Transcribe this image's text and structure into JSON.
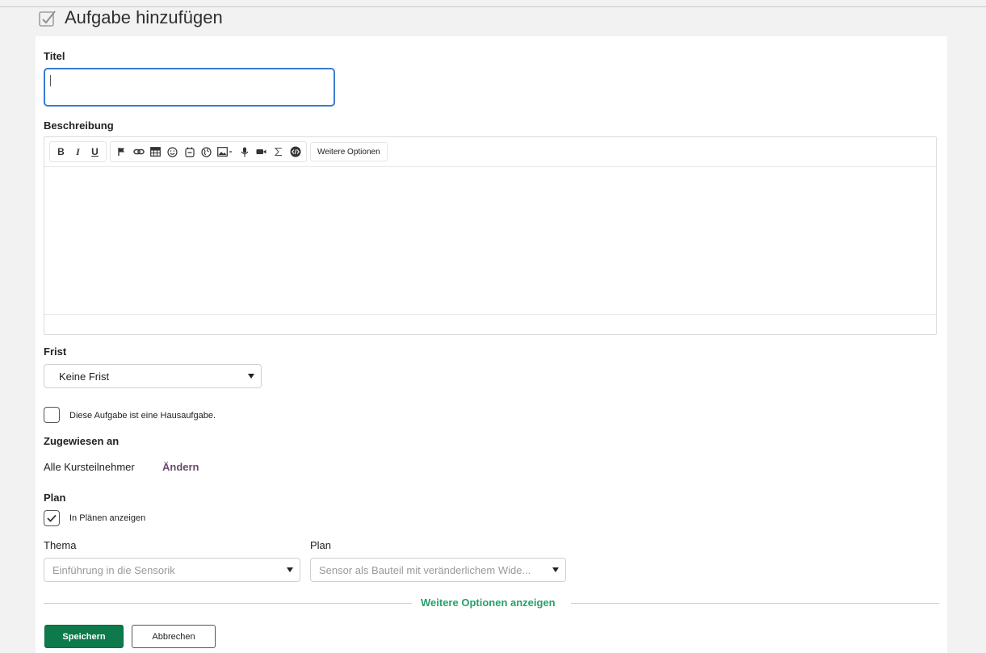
{
  "header": {
    "title": "Aufgabe hinzufügen",
    "icon": "task-check-icon"
  },
  "form": {
    "title_label": "Titel",
    "title_value": "",
    "description_label": "Beschreibung",
    "toolbar": {
      "bold": "B",
      "italic": "I",
      "underline": "U",
      "more_options": "Weitere Optionen",
      "icons": [
        "flag-icon",
        "link-icon",
        "table-icon",
        "emoji-icon",
        "calendar-icon",
        "globe-icon",
        "image-icon",
        "microphone-icon",
        "video-icon",
        "sigma-icon",
        "code-icon"
      ]
    },
    "deadline_label": "Frist",
    "deadline_value": "Keine Frist",
    "homework_label": "Diese Aufgabe ist eine Hausaufgabe.",
    "homework_checked": false,
    "assigned_label": "Zugewiesen an",
    "assigned_value": "Alle Kursteilnehmer",
    "assigned_change": "Ändern",
    "plan_section_label": "Plan",
    "show_in_plans_label": "In Plänen anzeigen",
    "show_in_plans_checked": true,
    "topic_label": "Thema",
    "topic_value": "Einführung in die Sensorik",
    "plan_label": "Plan",
    "plan_value": "Sensor als Bauteil mit veränderlichem Wide...",
    "more_options_link": "Weitere Optionen anzeigen",
    "save_label": "Speichern",
    "cancel_label": "Abbrechen"
  },
  "colors": {
    "accent_blue": "#3b7bd0",
    "primary_green": "#0e7a4b",
    "link_green": "#27a06a",
    "link_purple": "#6a4a6f"
  }
}
